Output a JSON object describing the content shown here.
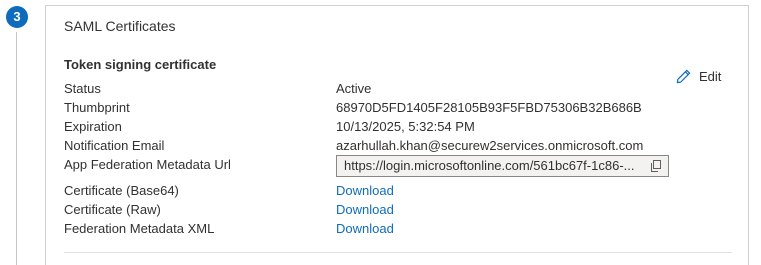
{
  "step": {
    "number": "3"
  },
  "card": {
    "title": "SAML Certificates",
    "section_title": "Token signing certificate",
    "edit_label": "Edit"
  },
  "fields": {
    "status": {
      "label": "Status",
      "value": "Active"
    },
    "thumbprint": {
      "label": "Thumbprint",
      "value": "68970D5FD1405F28105B93F5FBD75306B32B686B"
    },
    "expiration": {
      "label": "Expiration",
      "value": "10/13/2025, 5:32:54 PM"
    },
    "notification_email": {
      "label": "Notification Email",
      "value": "azarhullah.khan@securew2services.onmicrosoft.com"
    },
    "metadata_url": {
      "label": "App Federation Metadata Url",
      "value": "https://login.microsoftonline.com/561bc67f-1c86-..."
    },
    "cert_base64": {
      "label": "Certificate (Base64)",
      "link": "Download"
    },
    "cert_raw": {
      "label": "Certificate (Raw)",
      "link": "Download"
    },
    "federation_xml": {
      "label": "Federation Metadata XML",
      "link": "Download"
    }
  },
  "colors": {
    "accent": "#0f6cbd",
    "text": "#323130",
    "border": "#d2d0ce"
  },
  "icons": [
    "step-number-badge",
    "pencil-icon",
    "copy-icon"
  ]
}
